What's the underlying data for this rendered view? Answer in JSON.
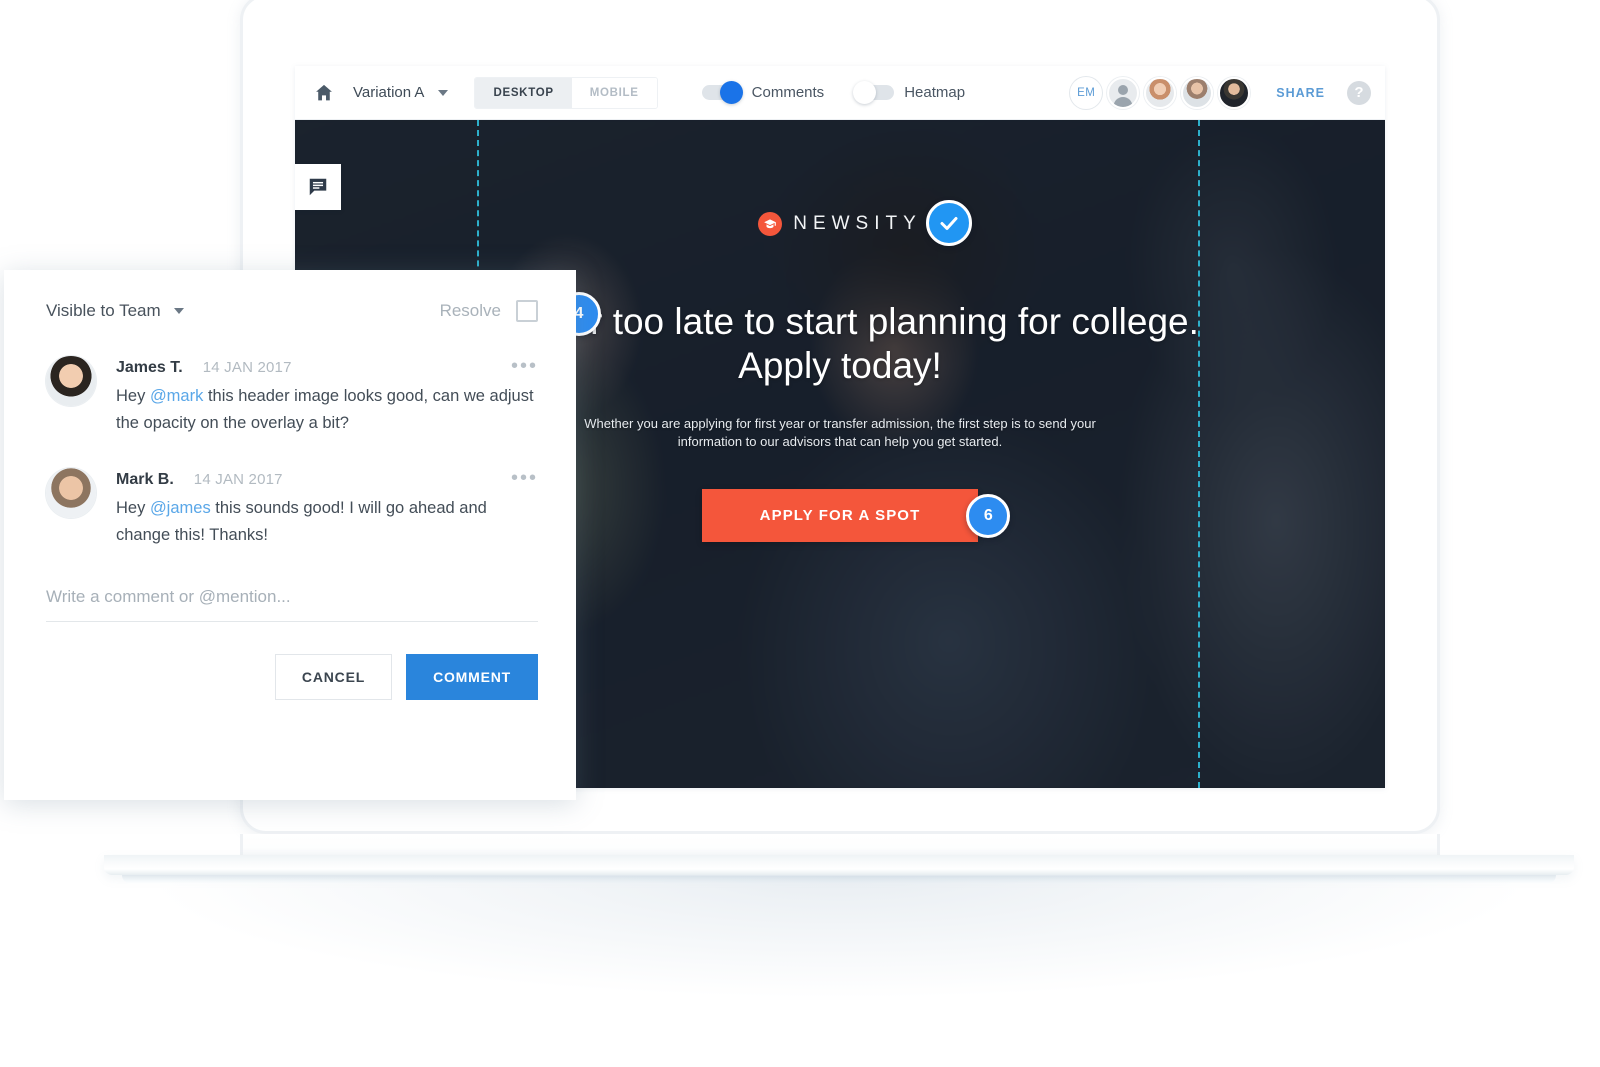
{
  "toolbar": {
    "home_icon": "home-icon",
    "variation_label": "Variation A",
    "variation_caret": "chevron-down-icon",
    "segments": [
      {
        "label": "DESKTOP",
        "active": true
      },
      {
        "label": "MOBILE",
        "active": false
      }
    ],
    "toggles": [
      {
        "label": "Comments",
        "state": "on"
      },
      {
        "label": "Heatmap",
        "state": "off"
      }
    ],
    "avatars": [
      {
        "type": "initials",
        "label": "EM"
      },
      {
        "type": "placeholder",
        "label": ""
      },
      {
        "type": "photo",
        "label": ""
      },
      {
        "type": "photo",
        "label": ""
      },
      {
        "type": "photo",
        "label": ""
      }
    ],
    "share_label": "SHARE",
    "help_label": "?"
  },
  "canvas": {
    "comment_tool_icon": "comment-bubble-icon",
    "check_badge_icon": "check-icon",
    "badges": [
      {
        "number": "4"
      },
      {
        "number": "6"
      }
    ],
    "hero": {
      "brand_name": "NEWSITY",
      "brand_mark_icon": "graduation-cap-icon",
      "headline": "s never too late to start planning for college. Apply today!",
      "subcopy": "Whether you are applying for first year or transfer admission, the first step is to send your information to our advisors that can help you get started.",
      "cta_label": "APPLY FOR A SPOT"
    }
  },
  "panel": {
    "visibility_label": "Visible to Team",
    "visibility_caret": "chevron-down-icon",
    "resolve_label": "Resolve",
    "comments": [
      {
        "author": "James T.",
        "date": "14 JAN 2017",
        "more_icon": "more-horizontal-icon",
        "text_before": "Hey ",
        "mention": "@mark",
        "text_after": " this header image looks good, can we adjust the opacity on the overlay a bit?"
      },
      {
        "author": "Mark B.",
        "date": "14 JAN 2017",
        "more_icon": "more-horizontal-icon",
        "text_before": "Hey ",
        "mention": "@james",
        "text_after": " this sounds good! I will go ahead and change this! Thanks!"
      }
    ],
    "input_placeholder": "Write a comment or @mention...",
    "cancel_label": "CANCEL",
    "comment_label": "COMMENT"
  },
  "colors": {
    "accent_blue": "#2d8cf0",
    "toggle_blue": "#1a73e8",
    "cta_orange": "#f4563b",
    "guide_cyan": "#2fb8d4",
    "comment_button_blue": "#2a85dc",
    "share_blue": "#5b9bd5",
    "mention_blue": "#5aa7e8"
  }
}
